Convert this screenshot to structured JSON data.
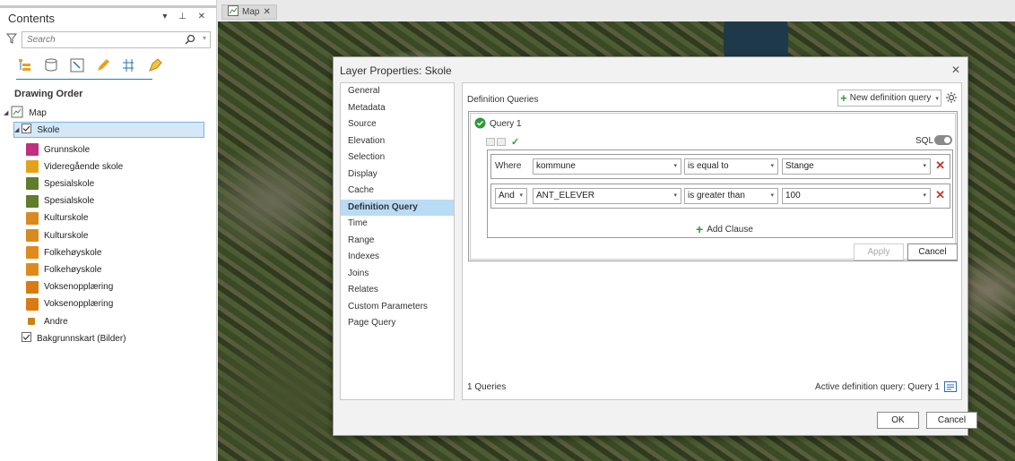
{
  "contents": {
    "title": "Contents",
    "header_controls": "▾ ⊥ ✕",
    "search_placeholder": "Search",
    "drawing_order_label": "Drawing Order",
    "map_item": "Map",
    "layer_item": "Skole",
    "sub_items": [
      {
        "label": "Grunnskole",
        "color": "#c0307f",
        "icon": "school-symbol-icon"
      },
      {
        "label": "Videregående skole",
        "color": "#e4a21b",
        "icon": "school-symbol-icon"
      },
      {
        "label": "Spesialskole",
        "color": "#5f7d2a",
        "icon": "school-symbol-icon"
      },
      {
        "label": "Spesialskole",
        "color": "#5f7d2a",
        "icon": "school-symbol-icon"
      },
      {
        "label": "Kulturskole",
        "color": "#d98a1f",
        "icon": "school-symbol-icon"
      },
      {
        "label": "Kulturskole",
        "color": "#d98a1f",
        "icon": "school-symbol-icon"
      },
      {
        "label": "Folkehøyskole",
        "color": "#e08a1c",
        "icon": "school-symbol-icon"
      },
      {
        "label": "Folkehøyskole",
        "color": "#e08a1c",
        "icon": "school-symbol-icon"
      },
      {
        "label": "Voksenopplæring",
        "color": "#d97b12",
        "icon": "school-symbol-icon"
      },
      {
        "label": "Voksenopplæring",
        "color": "#d97b12",
        "icon": "school-symbol-icon"
      },
      {
        "label": "Andre",
        "color": "#c88412",
        "icon": "square-symbol-icon"
      }
    ],
    "basemap_item": "Bakgrunnskart (Bilder)"
  },
  "map_tab": {
    "label": "Map",
    "close": "✕"
  },
  "dialog": {
    "title": "Layer Properties: Skole",
    "close": "✕",
    "nav_items": [
      "General",
      "Metadata",
      "Source",
      "Elevation",
      "Selection",
      "Display",
      "Cache",
      "Definition Query",
      "Time",
      "Range",
      "Indexes",
      "Joins",
      "Relates",
      "Custom Parameters",
      "Page Query"
    ],
    "selected_nav": "Definition Query",
    "definition_queries_label": "Definition Queries",
    "new_query_button": "New definition query",
    "query_name": "Query 1",
    "sql_label": "SQL",
    "clauses": [
      {
        "connector": "Where",
        "field": "kommune",
        "operator": "is equal to",
        "value": "Stange"
      },
      {
        "connector": "And",
        "field": "ANT_ELEVER",
        "operator": "is greater than",
        "value": "100"
      }
    ],
    "add_clause_label": "Add Clause",
    "apply_label": "Apply",
    "cancel_label": "Cancel",
    "queries_count": "1 Queries",
    "active_query": "Active definition query: Query 1",
    "ok_label": "OK",
    "dialog_cancel_label": "Cancel"
  }
}
